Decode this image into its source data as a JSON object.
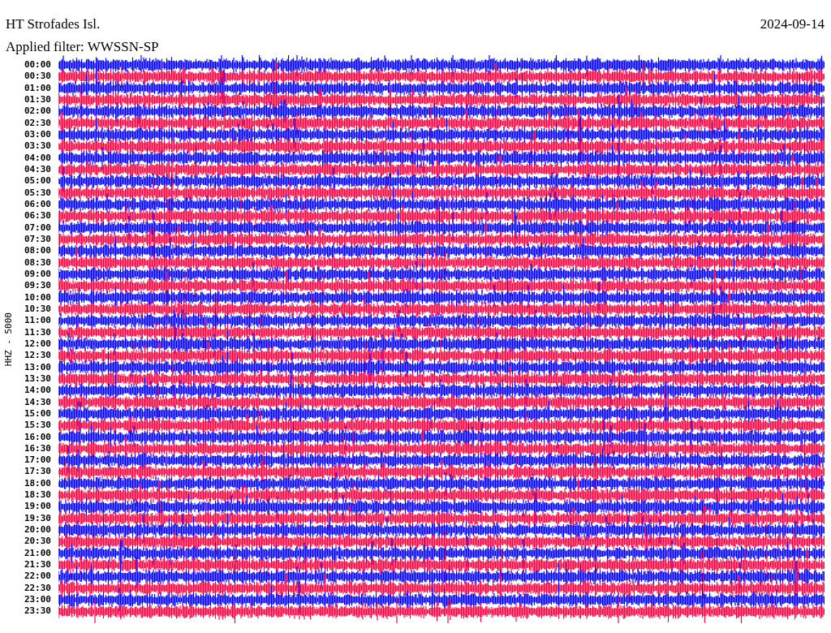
{
  "station": "HT Strofades Isl.",
  "date": "2024-09-14",
  "filter": "Applied filter: WWSSN-SP",
  "channel_label": "HHZ - 5000",
  "rows": [
    {
      "time": "00:00",
      "color": "#0000ff"
    },
    {
      "time": "00:30",
      "color": "#ff0040"
    },
    {
      "time": "01:00",
      "color": "#0000ff"
    },
    {
      "time": "01:30",
      "color": "#ff0040"
    },
    {
      "time": "02:00",
      "color": "#0000ff"
    },
    {
      "time": "02:30",
      "color": "#ff0040"
    },
    {
      "time": "03:00",
      "color": "#0000ff"
    },
    {
      "time": "03:30",
      "color": "#ff0040"
    },
    {
      "time": "04:00",
      "color": "#0000ff"
    },
    {
      "time": "04:30",
      "color": "#ff0040"
    },
    {
      "time": "05:00",
      "color": "#0000ff"
    },
    {
      "time": "05:30",
      "color": "#ff0040"
    },
    {
      "time": "06:00",
      "color": "#0000ff"
    },
    {
      "time": "06:30",
      "color": "#ff0040"
    },
    {
      "time": "07:00",
      "color": "#0000ff"
    },
    {
      "time": "07:30",
      "color": "#ff0040"
    },
    {
      "time": "08:00",
      "color": "#0000ff"
    },
    {
      "time": "08:30",
      "color": "#ff0040"
    },
    {
      "time": "09:00",
      "color": "#0000ff"
    },
    {
      "time": "09:30",
      "color": "#ff0040"
    },
    {
      "time": "10:00",
      "color": "#0000ff"
    },
    {
      "time": "10:30",
      "color": "#ff0040"
    },
    {
      "time": "11:00",
      "color": "#0000ff"
    },
    {
      "time": "11:30",
      "color": "#ff0040"
    },
    {
      "time": "12:00",
      "color": "#0000ff"
    },
    {
      "time": "12:30",
      "color": "#ff0040"
    },
    {
      "time": "13:00",
      "color": "#0000ff"
    },
    {
      "time": "13:30",
      "color": "#ff0040"
    },
    {
      "time": "14:00",
      "color": "#0000ff"
    },
    {
      "time": "14:30",
      "color": "#ff0040"
    },
    {
      "time": "15:00",
      "color": "#0000ff"
    },
    {
      "time": "15:30",
      "color": "#ff0040"
    },
    {
      "time": "16:00",
      "color": "#0000ff"
    },
    {
      "time": "16:30",
      "color": "#ff0040"
    },
    {
      "time": "17:00",
      "color": "#0000ff"
    },
    {
      "time": "17:30",
      "color": "#ff0040"
    },
    {
      "time": "18:00",
      "color": "#0000ff"
    },
    {
      "time": "18:30",
      "color": "#ff0040"
    },
    {
      "time": "19:00",
      "color": "#0000ff"
    },
    {
      "time": "19:30",
      "color": "#ff0040"
    },
    {
      "time": "20:00",
      "color": "#0000ff"
    },
    {
      "time": "20:30",
      "color": "#ff0040"
    },
    {
      "time": "21:00",
      "color": "#0000ff"
    },
    {
      "time": "21:30",
      "color": "#ff0040"
    },
    {
      "time": "22:00",
      "color": "#0000ff"
    },
    {
      "time": "22:30",
      "color": "#ff0040"
    },
    {
      "time": "23:00",
      "color": "#0000ff"
    },
    {
      "time": "23:30",
      "color": "#ff0040"
    }
  ]
}
